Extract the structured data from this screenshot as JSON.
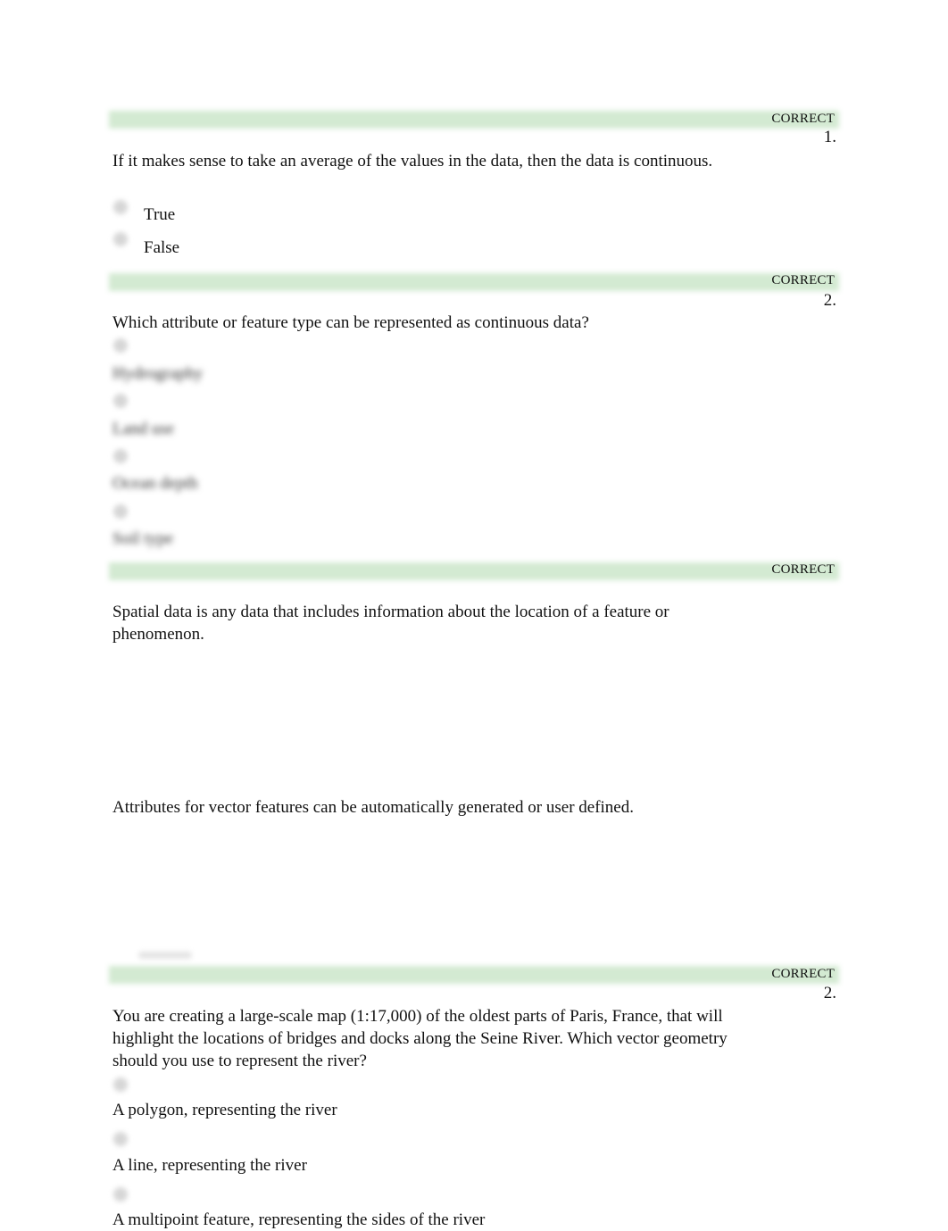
{
  "questions": [
    {
      "status": "CORRECT",
      "number": "1.",
      "text": "If it makes sense to take an average of the values in the data, then the data is continuous.",
      "options": [
        {
          "label": "True",
          "selected": true
        },
        {
          "label": "False",
          "selected": false
        }
      ]
    },
    {
      "status": "CORRECT",
      "number": "2.",
      "text": "Which attribute or feature type can be represented as continuous data?",
      "options": [
        {
          "label": "Hydrography",
          "selected": false
        },
        {
          "label": "Land use",
          "selected": false
        },
        {
          "label": "Ocean depth",
          "selected": true
        },
        {
          "label": "Soil type",
          "selected": false
        }
      ]
    },
    {
      "status": "CORRECT",
      "number": "",
      "text": "Spatial data is any data that includes information about the location of a feature or phenomenon.",
      "options": []
    },
    {
      "status": "",
      "number": "",
      "text": "Attributes for vector features can be automatically generated or user defined.",
      "options": []
    },
    {
      "status": "CORRECT",
      "number": "2.",
      "text": "You are creating a large-scale map (1:17,000) of the oldest parts of Paris, France, that will highlight the locations of bridges and docks along the Seine River. Which vector geometry should you use to represent the river?",
      "options": [
        {
          "label": "A polygon, representing the river",
          "selected": true
        },
        {
          "label": "A line, representing the river",
          "selected": false
        },
        {
          "label": "A multipoint feature, representing the sides of the river",
          "selected": false
        }
      ]
    }
  ],
  "colors": {
    "correct_bar": "#d3ead2",
    "text": "#111111"
  }
}
